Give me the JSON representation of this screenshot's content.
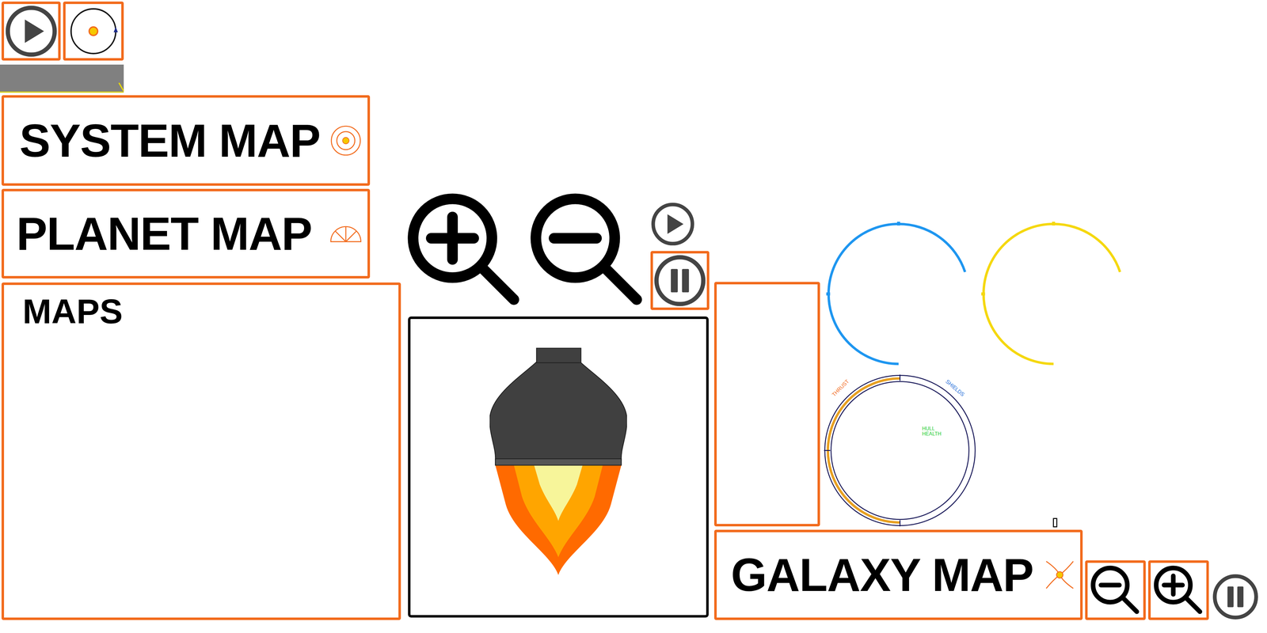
{
  "map_buttons": [
    {
      "label": "SYSTEM MAP"
    },
    {
      "label": "PLANET MAP"
    },
    {
      "label": "GALAXY MAP"
    }
  ],
  "maps_panel": {
    "title": "MAPS"
  },
  "status_gauge": {
    "thrust_label": "THRUST",
    "shields_label": "SHIELDS",
    "hull_label": "HULL HEALTH",
    "thrust_level": 0.5
  },
  "arc_meters": [
    {
      "color": "#1e96f0",
      "level": 0.7
    },
    {
      "color": "#f5d80f",
      "level": 0.7
    }
  ]
}
